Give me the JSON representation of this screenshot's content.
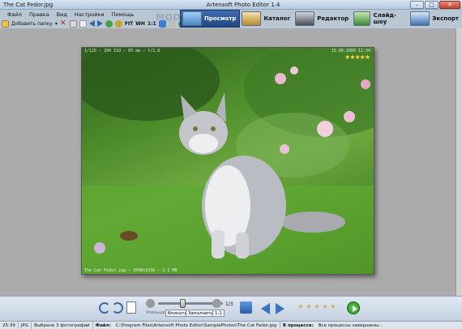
{
  "window": {
    "title_left": "The Cat Fedor.jpg",
    "title_app": "Artensoft Photo Editor 1.4",
    "min": "–",
    "max": "□",
    "close": "✕"
  },
  "menu": [
    "Файл",
    "Правка",
    "Вид",
    "Настройки",
    "Помощь"
  ],
  "toolbar": {
    "add_folder": "Добавить папку",
    "dropdown": "▾",
    "fit": "FIT",
    "wh": "WH",
    "one_to_one": "1:1"
  },
  "mode_label": "MODE:",
  "modes": [
    {
      "label": "Просмотр",
      "active": true,
      "icon": "photo-icon"
    },
    {
      "label": "Каталог",
      "active": false,
      "icon": "catalog-icon"
    },
    {
      "label": "Редактор",
      "active": false,
      "icon": "editor-icon"
    },
    {
      "label": "Слайд-шоу",
      "active": false,
      "icon": "slideshow-icon"
    },
    {
      "label": "Экспорт",
      "active": false,
      "icon": "export-icon"
    }
  ],
  "photo": {
    "caption_top": "1/125 — 200 ISO — 85 mm — f/2.8",
    "caption_date": "15.06.2009 12:34",
    "caption_bottom": "The Cat Fedor.jpg — 2048x1536 — 1.1 MB",
    "rating": 5
  },
  "bottom_bar": {
    "zoom_fraction": "1/3",
    "btn_fit": "Вписать",
    "btn_fill": "Заполнить",
    "btn_actual": "1:1",
    "btn_small": "Уменьшение"
  },
  "status": {
    "time": "25:39",
    "format": "JPG",
    "selected": "Выбрано 3 фотографий",
    "file_label": "Файл:",
    "file_path": "C:\\Program Files\\Artensoft Photo Editor\\SamplePhotos\\The Cat Fedor.jpg",
    "progress_label": "В процессе:",
    "progress_text": "Все процессы завершены..."
  },
  "colors": {
    "accent": "#22467f",
    "arrow": "#3c74c4",
    "play": "#1f8a1c"
  }
}
